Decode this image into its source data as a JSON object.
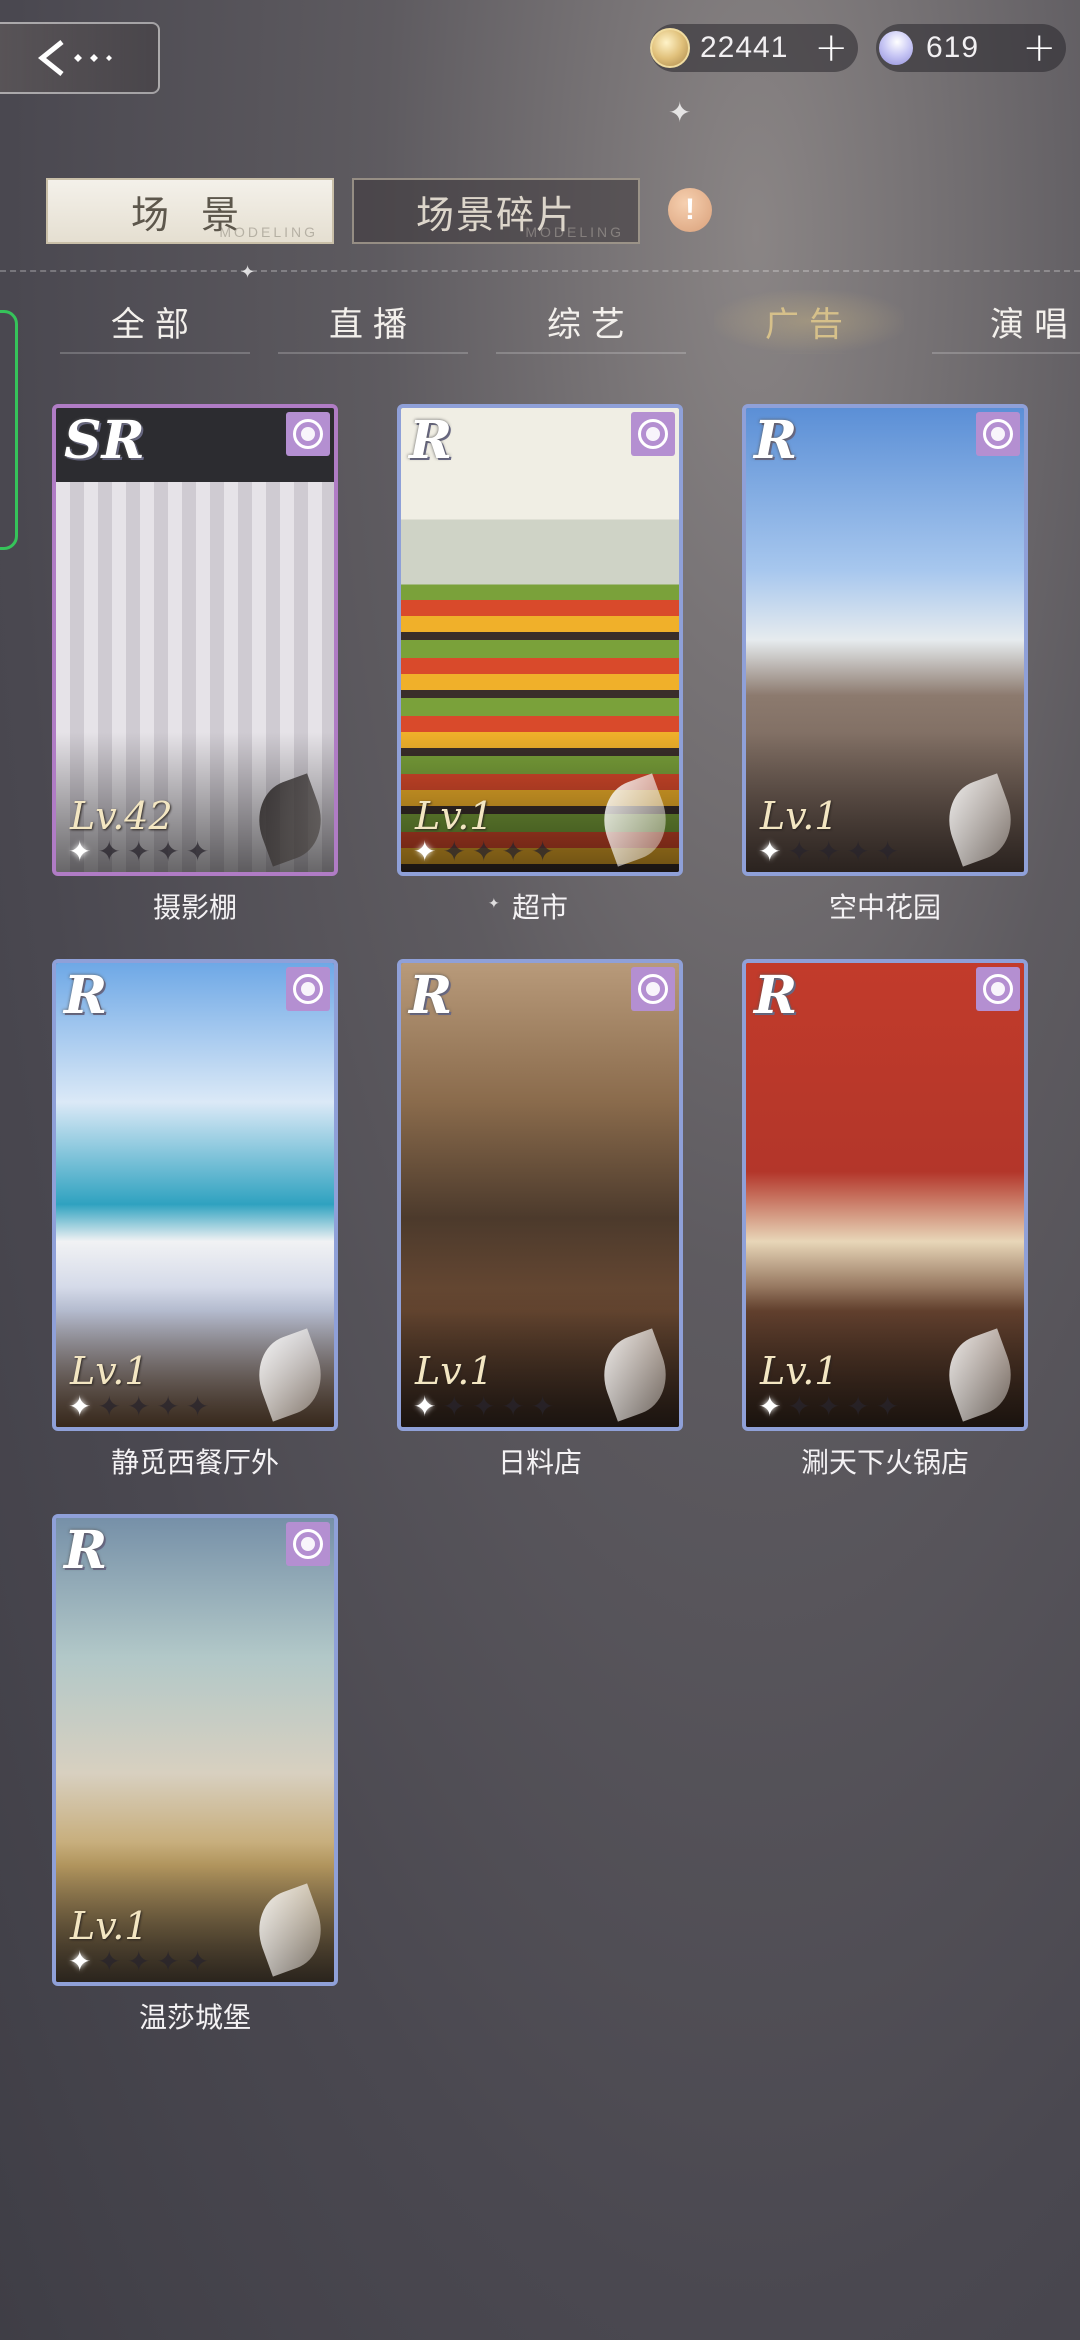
{
  "header": {
    "coins": "22441",
    "gems": "619",
    "plus_label": "+"
  },
  "main_tabs": [
    {
      "label": "场 景",
      "ghost": "MODELING",
      "active": true
    },
    {
      "label": "场景碎片",
      "ghost": "MODELING",
      "active": false
    }
  ],
  "alert_label": "!",
  "categories": [
    {
      "label": "全部",
      "selected": false
    },
    {
      "label": "直播",
      "selected": false
    },
    {
      "label": "综艺",
      "selected": false
    },
    {
      "label": "广告",
      "selected": true
    },
    {
      "label": "演唱",
      "selected": false
    }
  ],
  "scenes": [
    {
      "name": "摄影棚",
      "rarity": "SR",
      "level": "Lv.42",
      "stars": 1,
      "art": "studio"
    },
    {
      "name": "超市",
      "rarity": "R",
      "level": "Lv.1",
      "stars": 1,
      "art": "market"
    },
    {
      "name": "空中花园",
      "rarity": "R",
      "level": "Lv.1",
      "stars": 1,
      "art": "garden"
    },
    {
      "name": "静觅西餐厅外",
      "rarity": "R",
      "level": "Lv.1",
      "stars": 1,
      "art": "seaside"
    },
    {
      "name": "日料店",
      "rarity": "R",
      "level": "Lv.1",
      "stars": 1,
      "art": "japanese"
    },
    {
      "name": "涮天下火锅店",
      "rarity": "R",
      "level": "Lv.1",
      "stars": 1,
      "art": "hotpot"
    },
    {
      "name": "温莎城堡",
      "rarity": "R",
      "level": "Lv.1",
      "stars": 1,
      "art": "castle"
    }
  ],
  "colors": {
    "sr_frame": "#b07cc5",
    "r_frame": "#8fa0d8",
    "active_tab_bg": "#f4f1ea",
    "selected_category": "#d6c08a",
    "side_handle": "#36c35a"
  },
  "icons": [
    "back-arrow-icon",
    "coin-icon",
    "gem-icon",
    "plus-icon",
    "alert-icon",
    "camera-icon",
    "star-icon",
    "feather-icon"
  ]
}
